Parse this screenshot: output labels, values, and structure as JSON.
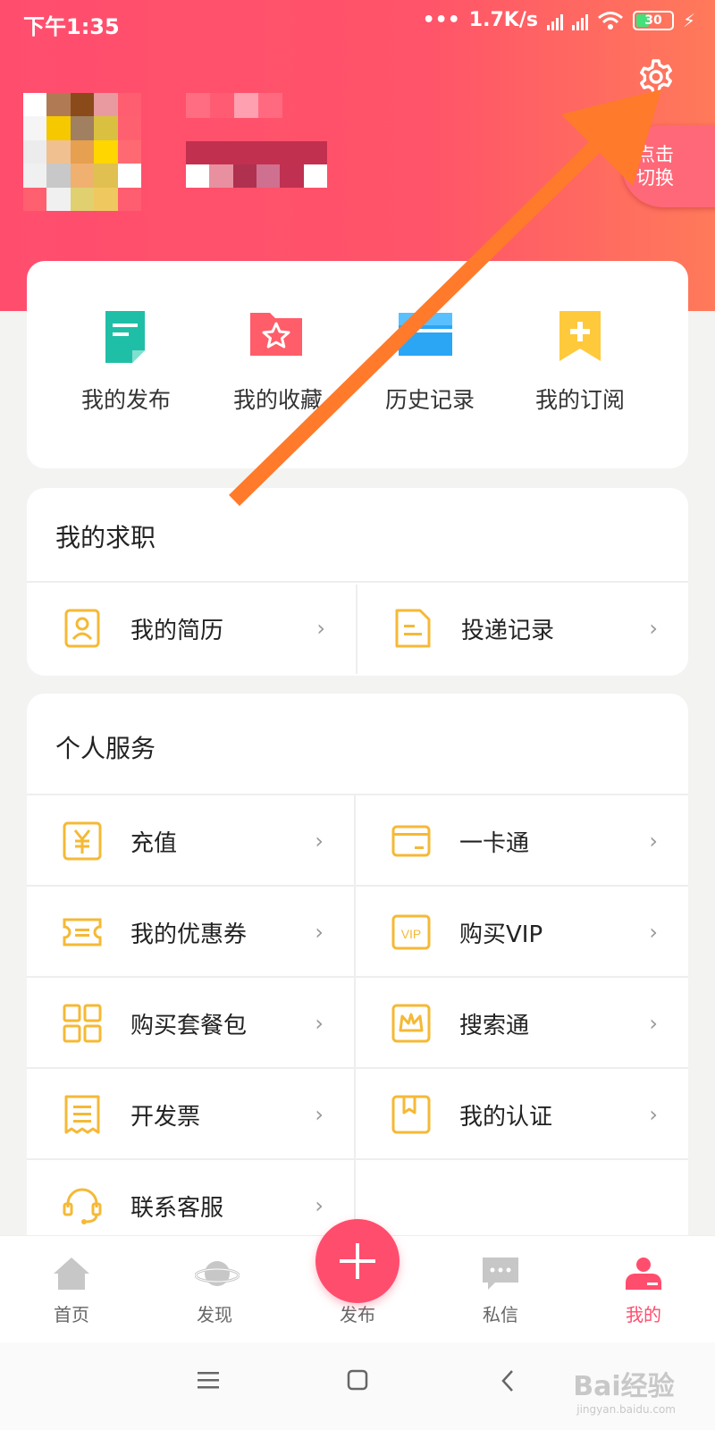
{
  "status_bar": {
    "time": "下午1:35",
    "network_speed": "1.7K/s",
    "battery": "30"
  },
  "header": {
    "switch_button": "点击\n切换"
  },
  "quick_actions": [
    {
      "label": "我的发布",
      "icon": "document-icon",
      "color": "#1fbfa7"
    },
    {
      "label": "我的收藏",
      "icon": "star-folder-icon",
      "color": "#ff5d69"
    },
    {
      "label": "历史记录",
      "icon": "history-folder-icon",
      "color": "#2aa6f5"
    },
    {
      "label": "我的订阅",
      "icon": "bookmark-plus-icon",
      "color": "#ffc93c"
    }
  ],
  "job_section": {
    "title": "我的求职",
    "items": [
      {
        "label": "我的简历",
        "icon": "resume-icon"
      },
      {
        "label": "投递记录",
        "icon": "delivery-record-icon"
      }
    ]
  },
  "services_section": {
    "title": "个人服务",
    "items": [
      {
        "label": "充值",
        "icon": "yuan-icon"
      },
      {
        "label": "一卡通",
        "icon": "card-icon"
      },
      {
        "label": "我的优惠券",
        "icon": "coupon-icon"
      },
      {
        "label": "购买VIP",
        "icon": "vip-icon"
      },
      {
        "label": "购买套餐包",
        "icon": "grid-icon"
      },
      {
        "label": "搜索通",
        "icon": "crown-icon"
      },
      {
        "label": "开发票",
        "icon": "receipt-icon"
      },
      {
        "label": "我的认证",
        "icon": "certification-icon"
      },
      {
        "label": "联系客服",
        "icon": "customer-service-icon"
      }
    ]
  },
  "tab_bar": [
    {
      "label": "首页",
      "icon": "home-icon",
      "active": false
    },
    {
      "label": "发现",
      "icon": "planet-icon",
      "active": false
    },
    {
      "label": "发布",
      "icon": "plus-icon",
      "active": false
    },
    {
      "label": "私信",
      "icon": "message-icon",
      "active": false
    },
    {
      "label": "我的",
      "icon": "profile-icon",
      "active": true
    }
  ],
  "watermark": {
    "main": "Bai经验",
    "sub": "jingyan.baidu.com"
  },
  "colors": {
    "brand": "#ff4d6e",
    "icon_yellow": "#f5b936",
    "annotation_arrow": "#ff7a2a"
  }
}
